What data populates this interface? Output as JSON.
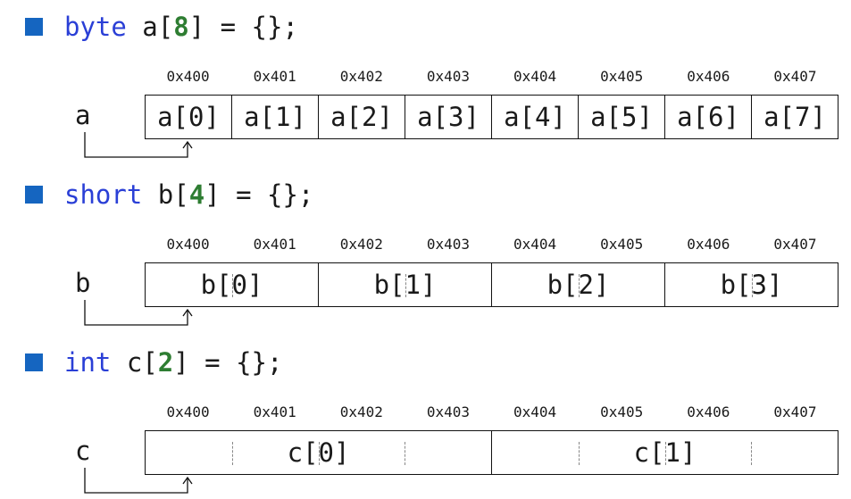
{
  "sections": [
    {
      "id": "byte",
      "decl": {
        "keyword": "byte",
        "name": " a[",
        "size": "8",
        "rest": "] = {};"
      },
      "var": "a",
      "addresses": [
        "0x400",
        "0x401",
        "0x402",
        "0x403",
        "0x404",
        "0x405",
        "0x406",
        "0x407"
      ],
      "cells": [
        "a[0]",
        "a[1]",
        "a[2]",
        "a[3]",
        "a[4]",
        "a[5]",
        "a[6]",
        "a[7]"
      ],
      "span": 1
    },
    {
      "id": "short",
      "decl": {
        "keyword": "short",
        "name": " b[",
        "size": "4",
        "rest": "] = {};"
      },
      "var": "b",
      "addresses": [
        "0x400",
        "0x401",
        "0x402",
        "0x403",
        "0x404",
        "0x405",
        "0x406",
        "0x407"
      ],
      "cells": [
        "b[0]",
        "b[1]",
        "b[2]",
        "b[3]"
      ],
      "span": 2
    },
    {
      "id": "int",
      "decl": {
        "keyword": "int",
        "name": " c[",
        "size": "2",
        "rest": "] = {};"
      },
      "var": "c",
      "addresses": [
        "0x400",
        "0x401",
        "0x402",
        "0x403",
        "0x404",
        "0x405",
        "0x406",
        "0x407"
      ],
      "cells": [
        "c[0]",
        "c[1]"
      ],
      "span": 4
    }
  ],
  "colors": {
    "bullet": "#1565c0",
    "keyword": "#2a3fd6",
    "size_number": "#2e7d32",
    "text": "#1a1a1a"
  }
}
